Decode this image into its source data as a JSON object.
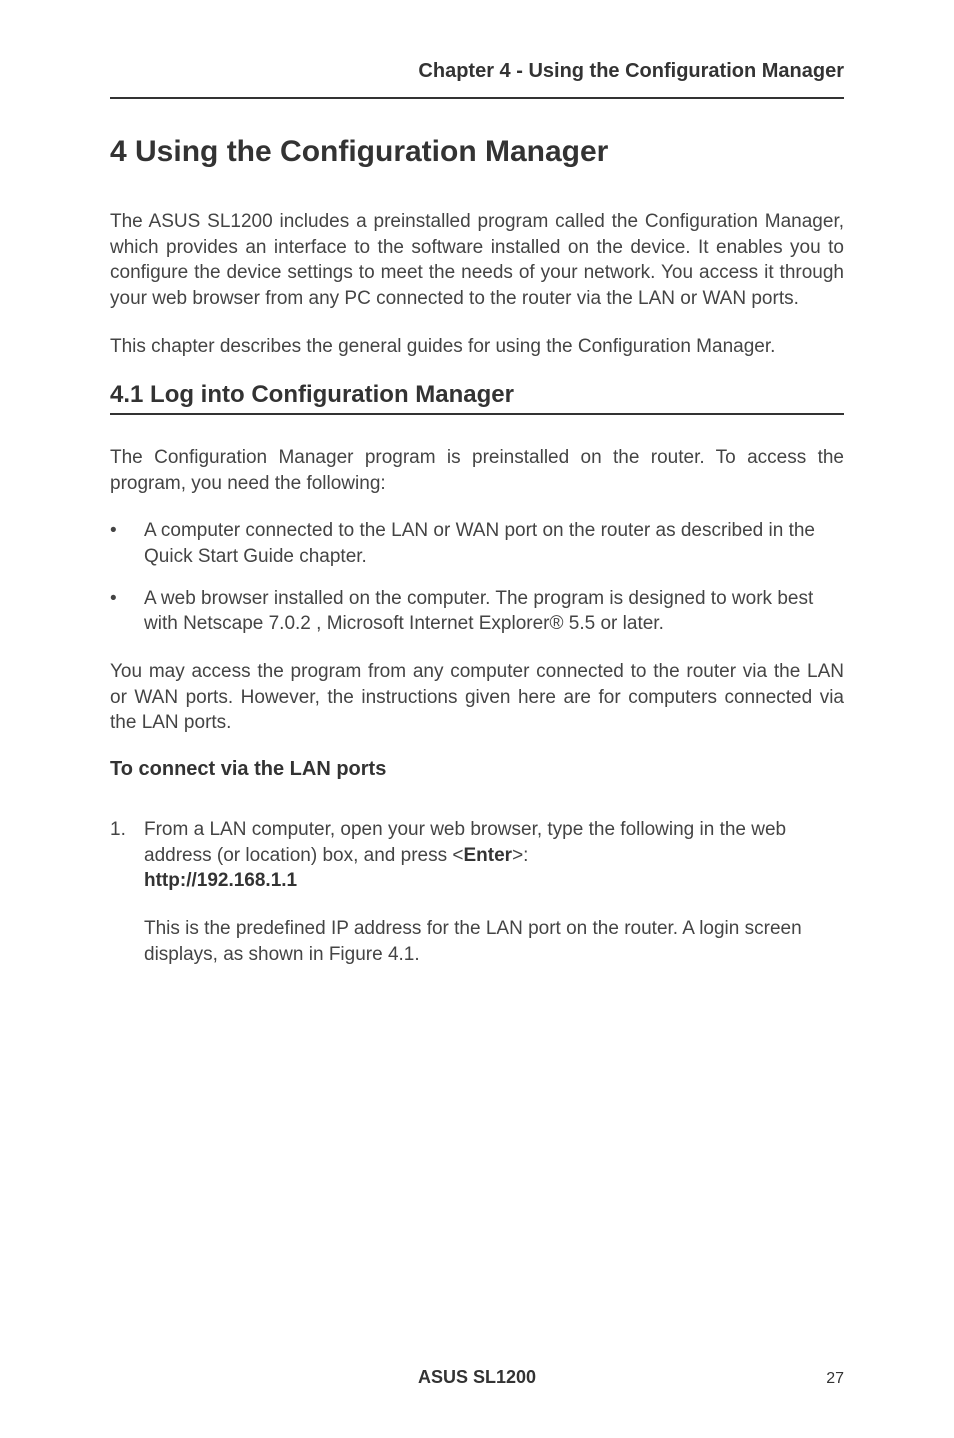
{
  "header": {
    "running_head": "Chapter 4 - Using the Configuration Manager"
  },
  "title": "4 Using the Configuration Manager",
  "intro_p1": "The ASUS SL1200 includes a preinstalled program called the Configuration Manager, which provides an interface to the software installed on the device. It enables you to configure the device settings to meet the needs of your network. You access it through your web browser from any PC connected to the router via the LAN or WAN ports.",
  "intro_p2": "This chapter describes the general guides for using the Configuration Manager.",
  "section_4_1": {
    "heading": "4.1 Log into Configuration Manager",
    "p1": "The Configuration Manager program is preinstalled on the router. To access the program, you need the following:",
    "bullets": [
      "A computer connected to the LAN or WAN port on the router as described in the Quick Start Guide chapter.",
      "A web browser installed on the computer. The program is designed to work best with Netscape 7.0.2 , Microsoft Internet Explorer® 5.5 or later."
    ],
    "p2": "You may access the program from any computer connected to the router via the LAN or WAN ports.  However, the instructions given here are for computers connected via the LAN ports.",
    "subhead": "To connect via the LAN ports",
    "step1_num": "1.",
    "step1_pre": "From a LAN computer, open your web browser, type the following in the web address (or location) box, and press <",
    "step1_bold1": "Enter",
    "step1_post": ">: ",
    "step1_bold2": "http://192.168.1.1",
    "step1_sub": "This is the predefined IP address for the LAN port on the router. A login screen displays, as shown in Figure 4.1."
  },
  "footer": {
    "product": "ASUS SL1200",
    "page": "27"
  }
}
